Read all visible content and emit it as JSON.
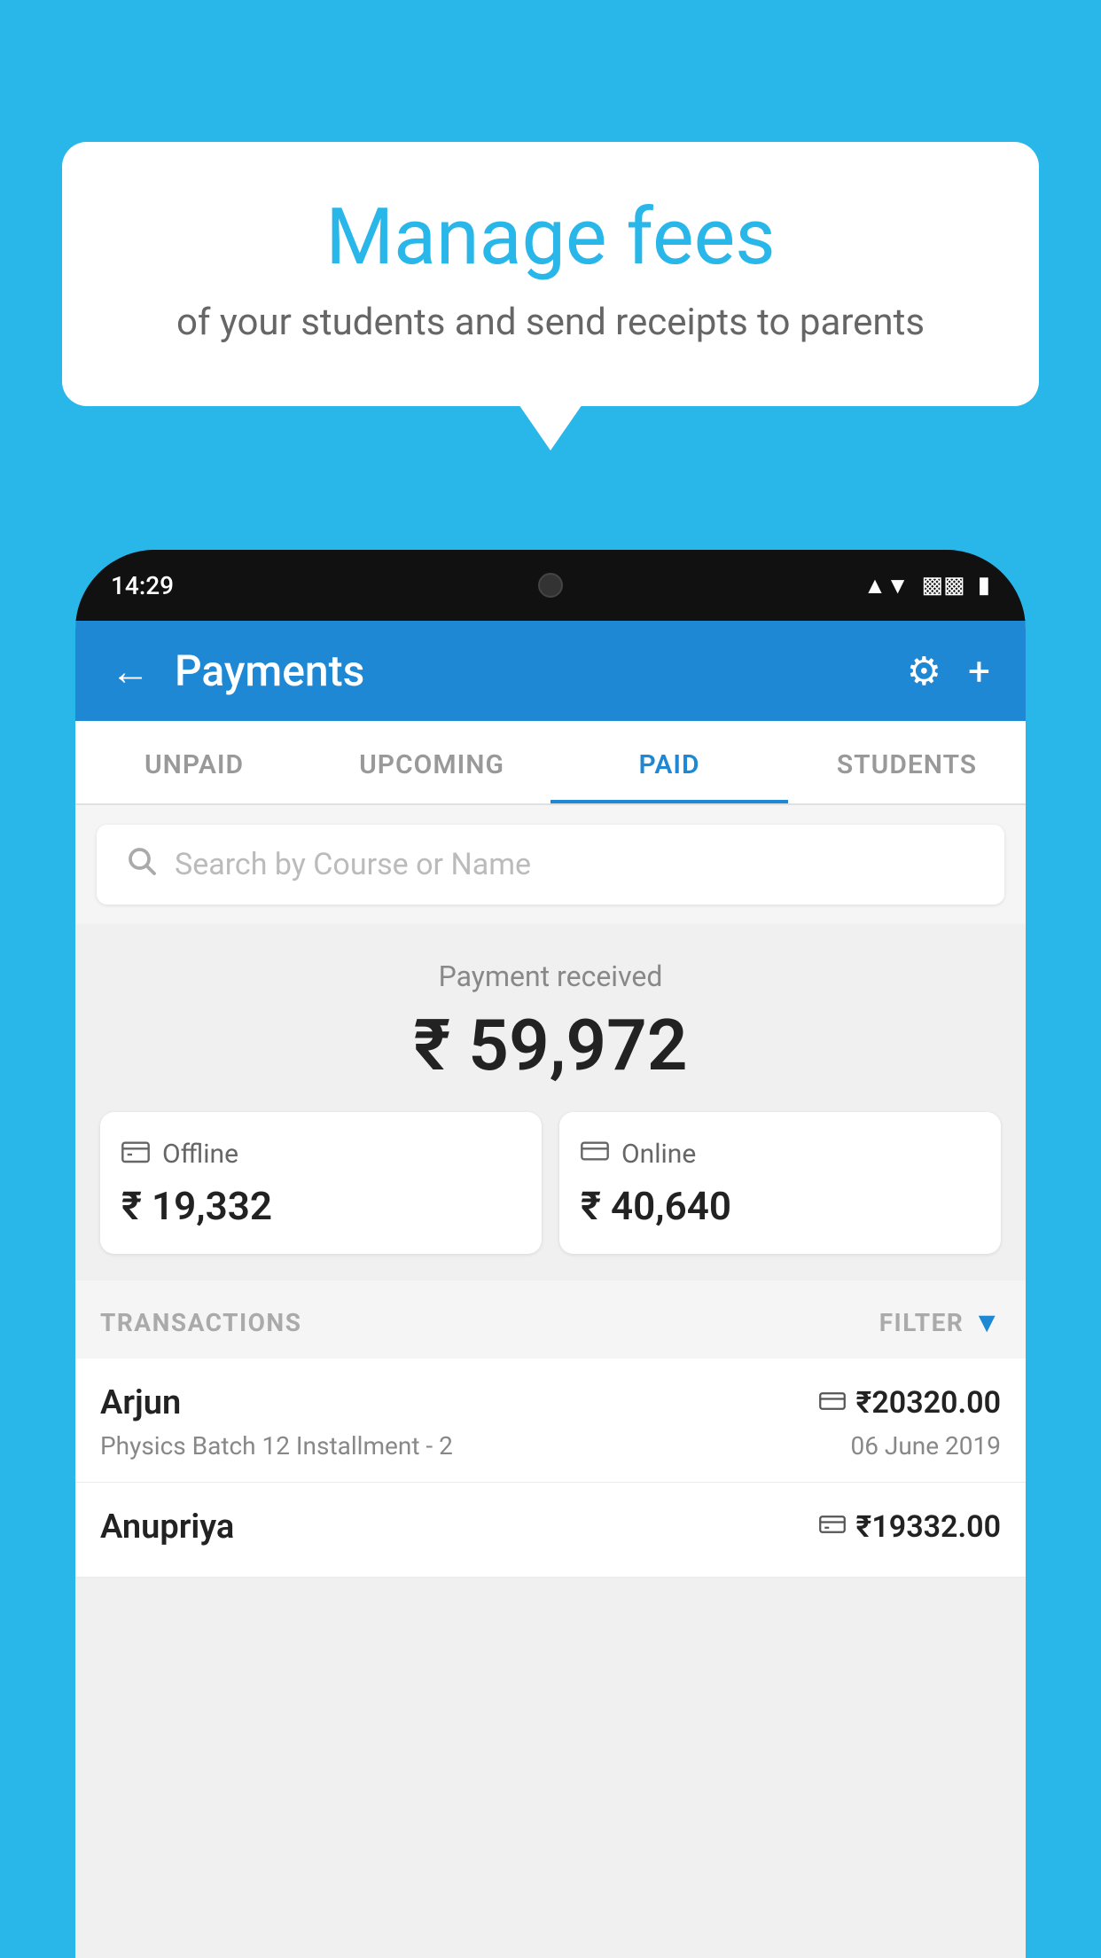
{
  "background_color": "#29b6e8",
  "bubble": {
    "title": "Manage fees",
    "subtitle": "of your students and send receipts to parents"
  },
  "status_bar": {
    "time": "14:29",
    "wifi_icon": "▼",
    "signal_icon": "▲",
    "battery_icon": "▮"
  },
  "header": {
    "title": "Payments",
    "back_label": "←",
    "gear_label": "⚙",
    "plus_label": "+"
  },
  "tabs": [
    {
      "id": "unpaid",
      "label": "UNPAID",
      "active": false
    },
    {
      "id": "upcoming",
      "label": "UPCOMING",
      "active": false
    },
    {
      "id": "paid",
      "label": "PAID",
      "active": true
    },
    {
      "id": "students",
      "label": "STUDENTS",
      "active": false
    }
  ],
  "search": {
    "placeholder": "Search by Course or Name"
  },
  "payment_summary": {
    "label": "Payment received",
    "amount": "₹ 59,972",
    "offline": {
      "label": "Offline",
      "amount": "₹ 19,332"
    },
    "online": {
      "label": "Online",
      "amount": "₹ 40,640"
    }
  },
  "transactions": {
    "header": "TRANSACTIONS",
    "filter": "FILTER",
    "rows": [
      {
        "name": "Arjun",
        "course": "Physics Batch 12 Installment - 2",
        "amount": "₹20320.00",
        "date": "06 June 2019",
        "payment_type": "card"
      },
      {
        "name": "Anupriya",
        "course": "",
        "amount": "₹19332.00",
        "date": "",
        "payment_type": "offline"
      }
    ]
  }
}
